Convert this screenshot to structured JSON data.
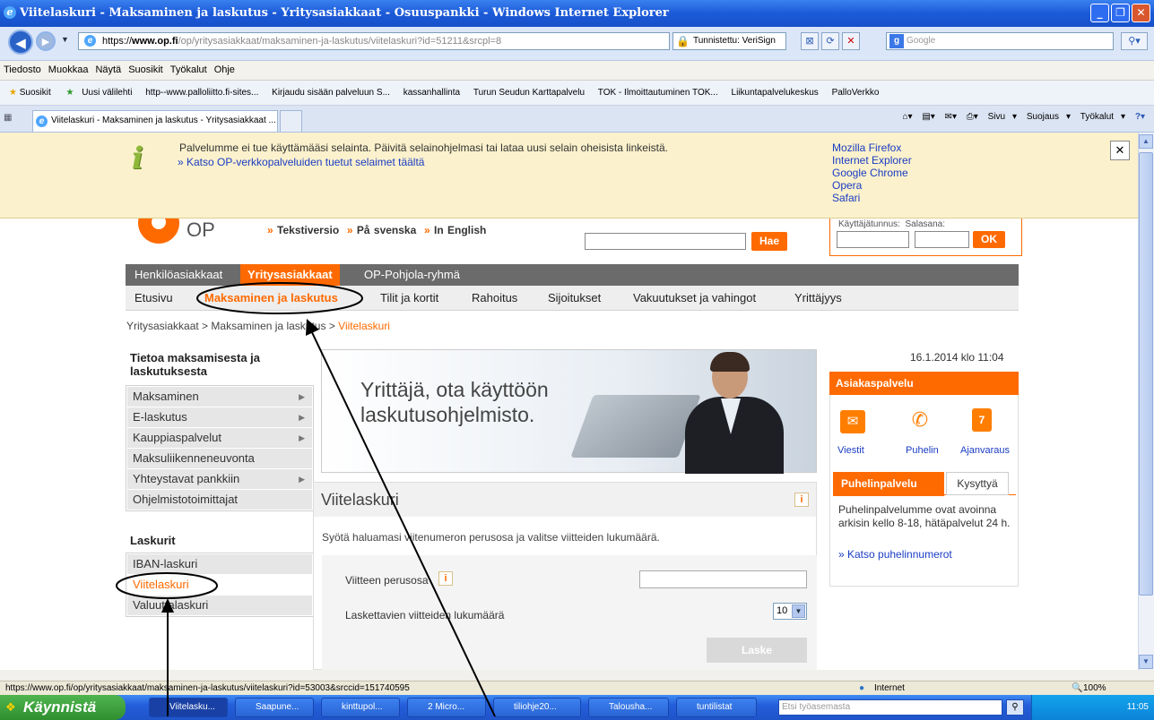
{
  "window": {
    "title": "Viitelaskuri - Maksaminen ja laskutus - Yritysasiakkaat - Osuuspankki - Windows Internet Explorer"
  },
  "address": {
    "url_https": "https://",
    "url_host": "www.op.fi",
    "url_path": "/op/yritysasiakkaat/maksaminen-ja-laskutus/viitelaskuri?id=51211&srcpl=8",
    "security": "Tunnistettu: VeriSign",
    "search_placeholder": "Google"
  },
  "menu": [
    "Tiedosto",
    "Muokkaa",
    "Näytä",
    "Suosikit",
    "Työkalut",
    "Ohje"
  ],
  "favorites": {
    "label": "Suosikit",
    "items": [
      "Uusi välilehti",
      "http--www.palloliitto.fi-sites...",
      "Kirjaudu sisään palveluun S...",
      "kassanhallinta",
      "Turun Seudun Karttapalvelu",
      "TOK - Ilmoittautuminen TOK...",
      "Liikuntapalvelukeskus",
      "PalloVerkko"
    ]
  },
  "tab": {
    "title": "Viitelaskuri - Maksaminen ja laskutus - Yritysasiakkaat ..."
  },
  "commandbar": {
    "page": "Sivu",
    "safety": "Suojaus",
    "tools": "Työkalut"
  },
  "infobar": {
    "message": "Palvelumme ei tue käyttämääsi selainta. Päivitä selainohjelmasi tai lataa uusi selain oheisista linkeistä.",
    "link": "» Katso OP-verkkopalveluiden tuetut selaimet täältä",
    "browsers": [
      "Mozilla Firefox",
      "Internet Explorer",
      "Google Chrome",
      "Opera",
      "Safari"
    ]
  },
  "header": {
    "logo": "OP",
    "lang1": "Tekstiversio",
    "lang2": "På svenska",
    "lang3": "In English",
    "search_btn": "Hae",
    "username_label": "Käyttäjätunnus:",
    "password_label": "Salasana:",
    "ok": "OK"
  },
  "topnav": [
    "Henkilöasiakkaat",
    "Yritysasiakkaat",
    "OP-Pohjola-ryhmä"
  ],
  "subnav": [
    "Etusivu",
    "Maksaminen ja laskutus",
    "Tilit ja kortit",
    "Rahoitus",
    "Sijoitukset",
    "Vakuutukset ja vahingot",
    "Yrittäjyys"
  ],
  "breadcrumb": {
    "a": "Yritysasiakkaat",
    "b": "Maksaminen ja laskutus",
    "c": "Viitelaskuri",
    "sep": ">"
  },
  "sidebar": {
    "heading1": "Tietoa maksamisesta ja laskutuksesta",
    "items1": [
      "Maksaminen",
      "E-laskutus",
      "Kauppiaspalvelut",
      "Maksuliikenneneuvonta",
      "Yhteystavat pankkiin",
      "Ohjelmistotoimittajat"
    ],
    "heading2": "Laskurit",
    "items2": [
      "IBAN-laskuri",
      "Viitelaskuri",
      "Valuuttalaskuri"
    ]
  },
  "banner": {
    "line1": "Yrittäjä, ota käyttöön",
    "line2": "laskutusohjelmisto."
  },
  "calc": {
    "title": "Viitelaskuri",
    "desc": "Syötä haluamasi viitenumeron perusosa ja valitse viitteiden lukumäärä.",
    "field1": "Viitteen perusosa",
    "field2": "Laskettavien viitteiden lukumäärä",
    "count": "10",
    "button": "Laske"
  },
  "right": {
    "date": "16.1.2014 klo 11:04",
    "service_title": "Asiakaspalvelu",
    "c1": "Viestit",
    "c2": "Puhelin",
    "c3": "Ajanvaraus",
    "tab1": "Puhelinpalvelu",
    "tab2": "Kysyttyä",
    "text": "Puhelinpalvelumme ovat avoinna arkisin kello 8-18, hätäpalvelut 24 h.",
    "link": "» Katso puhelinnumerot"
  },
  "status": {
    "url": "https://www.op.fi/op/yritysasiakkaat/maksaminen-ja-laskutus/viitelaskuri?id=53003&srccid=151740595",
    "zone": "Internet",
    "zoom": "100%"
  },
  "taskbar": {
    "start": "Käynnistä",
    "items": [
      "Viitelasku...",
      "Saapune...",
      "kinttupol...",
      "2 Micro...",
      "tiliohje20...",
      "Talousha...",
      "tuntilistat"
    ],
    "search_placeholder": "Etsi työasemasta",
    "clock": "11:05"
  }
}
